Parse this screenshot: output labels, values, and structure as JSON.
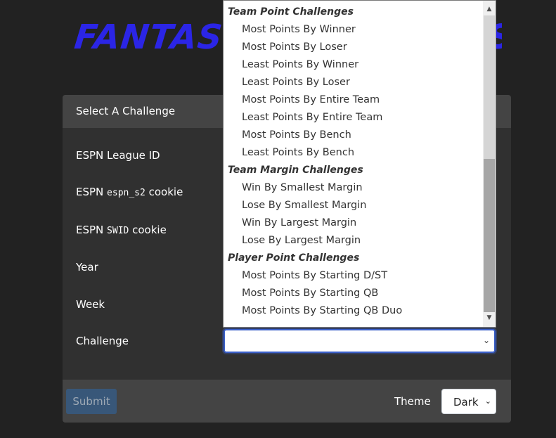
{
  "header": {
    "logo_text": "FANTASY FO",
    "logo_tail": "S"
  },
  "card": {
    "title": "Select A Challenge",
    "rows": [
      {
        "label": "ESPN League ID"
      },
      {
        "label_pre": "ESPN ",
        "label_code": "espn_s2",
        "label_post": " cookie"
      },
      {
        "label_pre": "ESPN ",
        "label_code": "SWID",
        "label_post": " cookie"
      },
      {
        "label": "Year"
      },
      {
        "label": "Week"
      },
      {
        "label": "Challenge",
        "value": ""
      }
    ]
  },
  "footer": {
    "submit_label": "Submit",
    "theme_label": "Theme",
    "theme_value": "Dark"
  },
  "dropdown": {
    "groups": [
      {
        "label": "Team Point Challenges",
        "options": [
          "Most Points By Winner",
          "Most Points By Loser",
          "Least Points By Winner",
          "Least Points By Loser",
          "Most Points By Entire Team",
          "Least Points By Entire Team",
          "Most Points By Bench",
          "Least Points By Bench"
        ]
      },
      {
        "label": "Team Margin Challenges",
        "options": [
          "Win By Smallest Margin",
          "Lose By Smallest Margin",
          "Win By Largest Margin",
          "Lose By Largest Margin"
        ]
      },
      {
        "label": "Player Point Challenges",
        "options": [
          "Most Points By Starting D/ST",
          "Most Points By Starting QB",
          "Most Points By Starting QB Duo"
        ]
      }
    ],
    "scrollbar": {
      "up_icon": "triangle-up",
      "down_icon": "triangle-down"
    }
  },
  "colors": {
    "background": "#222222",
    "card": "#303030",
    "card_header": "#444444",
    "logo": "#2b25e6",
    "submit": "#375a7f",
    "focus": "#3a5fc8"
  }
}
